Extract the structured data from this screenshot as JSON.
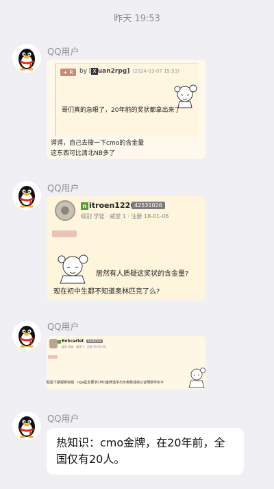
{
  "timestamp": "昨天 19:53",
  "messages": [
    {
      "sender": "QQ用户",
      "avatar_icon": "qq-penguin-icon",
      "image": {
        "tag": "+ R",
        "by_prefix": "by [",
        "username_mark": "x",
        "username": "uan2rpg]",
        "date": "(2024-03-07 15:53)",
        "quote_text": "哥们真的急眼了，20年前的奖状都拿出来了",
        "line1": "谔谔，自己去搜一下cmo的含金量",
        "line2": "这东西可比清北NB多了"
      }
    },
    {
      "sender": "QQ用户",
      "avatar_icon": "qq-penguin-icon",
      "image": {
        "username_mark": "n",
        "username": "itroen1226",
        "uid": "42531026",
        "meta": "级别 学徒 · 威望 1 · 注册  18-01-06",
        "quote": "居然有人质疑这奖状的含金量?",
        "text": "现在初中生都不知道奥林匹克了么?"
      }
    },
    {
      "sender": "QQ用户",
      "avatar_icon": "qq-penguin-icon",
      "image": {
        "username": "EnScarlet",
        "uid": "60462594",
        "meta": "级别 学徒 · 威望 1 · 注册  19-05-30",
        "text": "联盟下期视频标题：nga星友要求CMO金牌选手出示奥数成绩以证明数学水平"
      }
    },
    {
      "sender": "QQ用户",
      "avatar_icon": "qq-penguin-icon",
      "text": "热知识：cmo金牌，在20年前，全国仅有20人。"
    }
  ],
  "colors": {
    "background": "#efeff4",
    "bubble": "#ffffff",
    "sender_gray": "#8d8d92",
    "qq_red_scarf": "#e02a1f"
  }
}
